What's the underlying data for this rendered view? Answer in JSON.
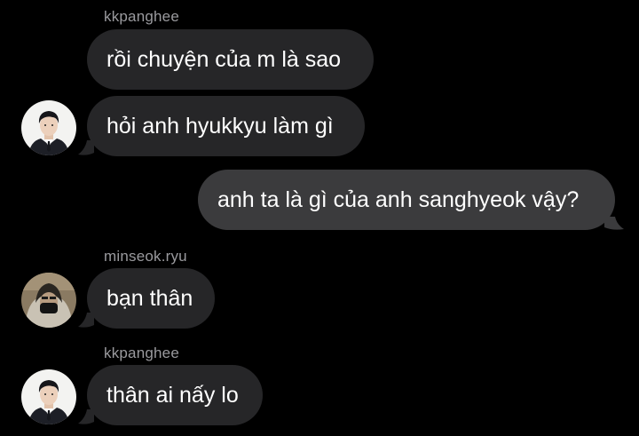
{
  "colors": {
    "background": "#000000",
    "incoming_bubble": "#262628",
    "outgoing_bubble": "#3b3b3d",
    "sender_name": "#9a9a9e",
    "text": "#ffffff"
  },
  "messages": [
    {
      "sender": "kkpanghee",
      "text": "rồi chuyện của m là sao",
      "direction": "incoming"
    },
    {
      "sender": "kkpanghee",
      "text": "hỏi anh hyukkyu làm gì",
      "direction": "incoming",
      "avatar": "kkpanghee-avatar"
    },
    {
      "text": "anh ta là gì của anh sanghyeok vậy?",
      "direction": "outgoing"
    },
    {
      "sender": "minseok.ryu",
      "text": "bạn thân",
      "direction": "incoming",
      "avatar": "minseok-avatar"
    },
    {
      "sender": "kkpanghee",
      "text": "thân ai nấy lo",
      "direction": "incoming",
      "avatar": "kkpanghee-avatar"
    }
  ],
  "sender_labels": {
    "group1": "kkpanghee",
    "group2": "minseok.ryu",
    "group3": "kkpanghee"
  }
}
